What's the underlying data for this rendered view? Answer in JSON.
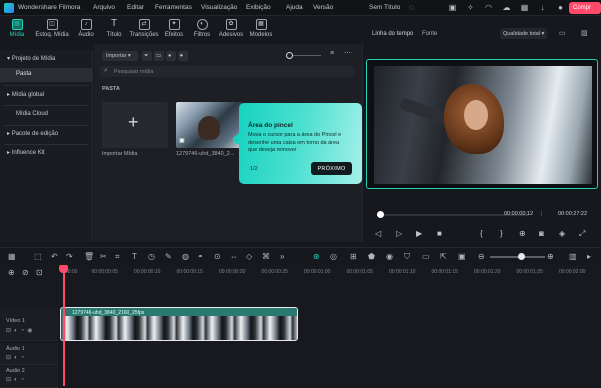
{
  "menubar": {
    "app_title": "Wondershare Filmora",
    "items": [
      "Arquivo",
      "Editar",
      "Ferramentas",
      "Visualização",
      "Exibição",
      "Ajuda",
      "Versão"
    ],
    "project_title": "Sem Título",
    "buy_label": "Compr"
  },
  "toolbar": {
    "tools": [
      {
        "label": "Mídia",
        "icon": "media-icon",
        "active": true
      },
      {
        "label": "Estoq. Mídia",
        "icon": "stock-media-icon"
      },
      {
        "label": "Áudio",
        "icon": "audio-icon"
      },
      {
        "label": "Título",
        "icon": "title-icon"
      },
      {
        "label": "Transições",
        "icon": "transitions-icon"
      },
      {
        "label": "Efeitos",
        "icon": "effects-icon"
      },
      {
        "label": "Filtros",
        "icon": "filters-icon"
      },
      {
        "label": "Adesivos",
        "icon": "stickers-icon"
      },
      {
        "label": "Modelos",
        "icon": "templates-icon"
      }
    ]
  },
  "sidebar": {
    "items": [
      {
        "label": "Projeto de Mídia",
        "expanded": true
      },
      {
        "label": "Pasta",
        "selected": true
      },
      {
        "label": "Mídia global"
      },
      {
        "label": "Mídia Cloud"
      },
      {
        "label": "Pacote de edição"
      },
      {
        "label": "Influence Kit"
      }
    ]
  },
  "media": {
    "import_button": "Importar",
    "search_placeholder": "Pesquisar mídia",
    "folder_label": "PASTA",
    "import_tile_label": "Importar Mídia",
    "clip_name": "1279746-uhd_3840_2..."
  },
  "popup": {
    "title": "Área do pincel",
    "description": "Mova o cursor para a área do Pincel e desenhe uma caixa em torno da área que deseja remover",
    "step": "1/2",
    "next_label": "PRÓXIMO"
  },
  "player": {
    "tabs": [
      "Linha do tempo",
      "Fonte"
    ],
    "quality": "Qualidade total",
    "current_time": "00:00:00:12",
    "total_time": "00:00:27:22",
    "progress": 0.02
  },
  "timeline": {
    "ticks": [
      "00:00",
      "00:00:00:05",
      "00:00:00:10",
      "00:00:00:15",
      "00:00:00:20",
      "00:00:00:25",
      "00:00:01:00",
      "00:00:01:05",
      "00:00:01:10",
      "00:00:01:15",
      "00:00:01:20",
      "00:00:01:25",
      "00:00:02:00"
    ],
    "tracks": [
      "Vídeo 1",
      "Áudio 1",
      "Áudio 2"
    ],
    "clip_label": "1279746-uhd_3840_2160_25fps"
  },
  "colors": {
    "accent": "#25d3b9",
    "playhead": "#ff4a6a",
    "buy": "#ff4a6a"
  }
}
